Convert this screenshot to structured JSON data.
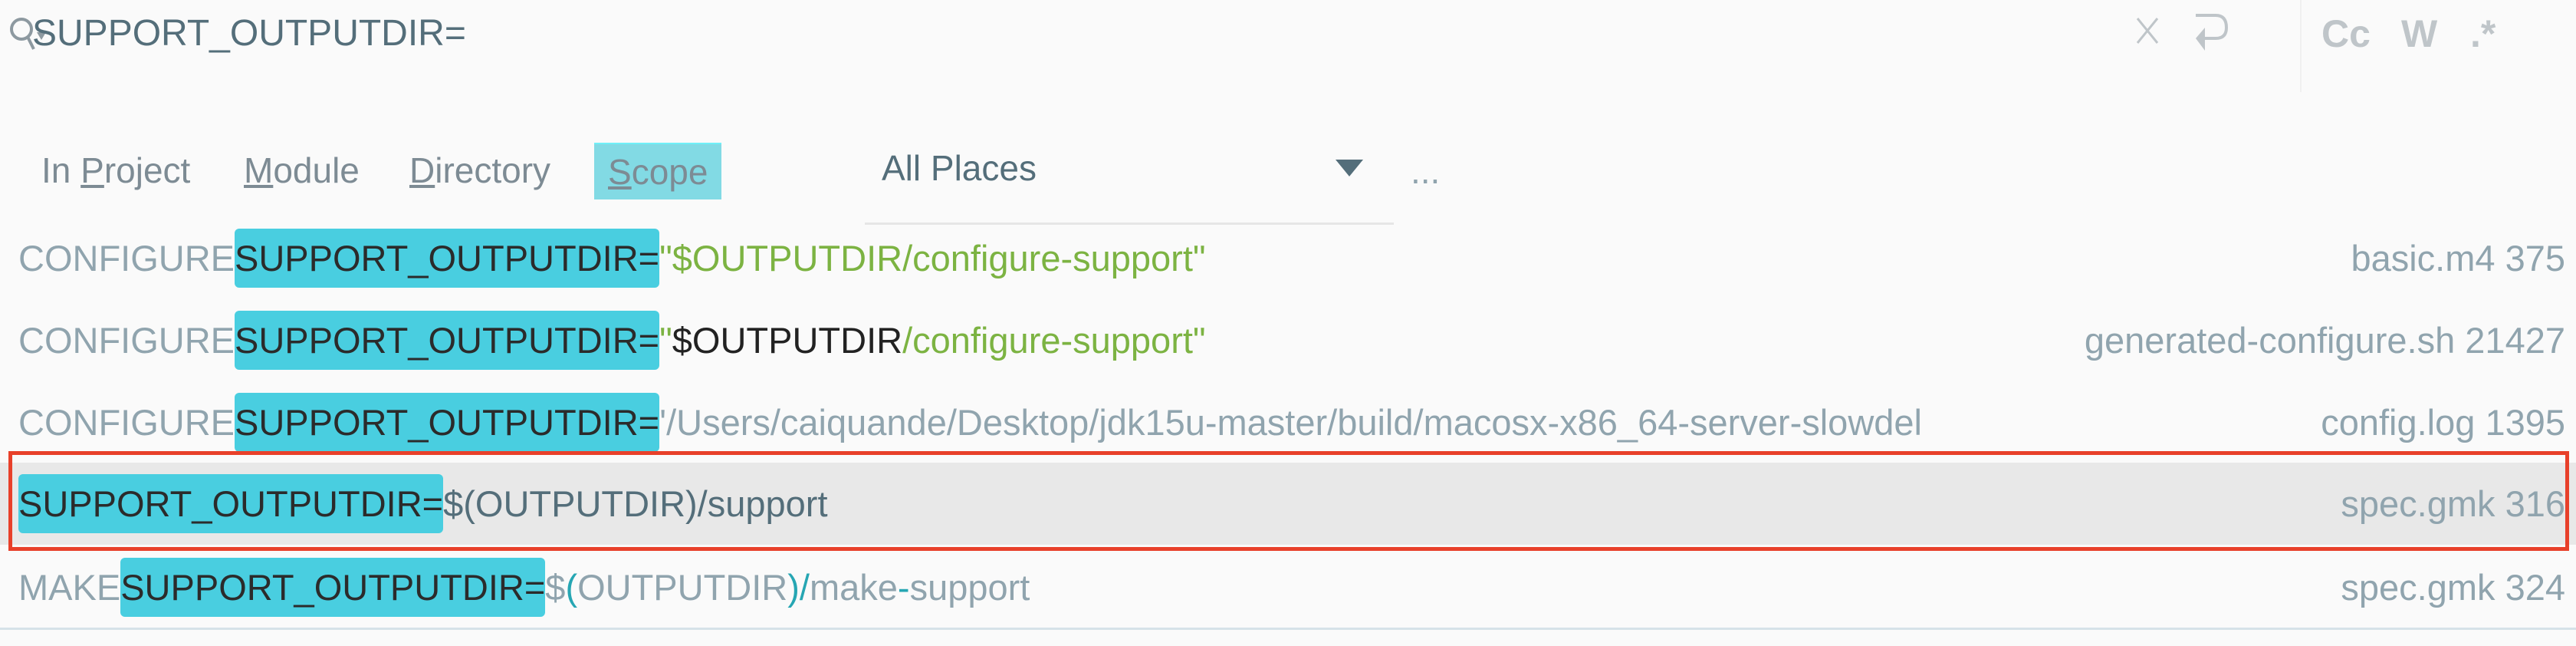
{
  "search": {
    "query": "SUPPORT_OUTPUTDIR=",
    "icons": [
      "search-icon",
      "clear-icon",
      "new-line-icon"
    ],
    "toggles": {
      "match_case": "Cc",
      "words": "W",
      "regex": ".*"
    }
  },
  "scope_tabs": [
    {
      "label": "In Project",
      "mnemonic": "P"
    },
    {
      "label": "Module",
      "mnemonic": "M"
    },
    {
      "label": "Directory",
      "mnemonic": "D"
    },
    {
      "label": "Scope",
      "mnemonic": "S",
      "active": true
    }
  ],
  "scope_select": {
    "value": "All Places"
  },
  "more_label": "...",
  "results": [
    {
      "prefix": "CONFIGURE",
      "match": "SUPPORT_OUTPUTDIR=",
      "rest": [
        "\"$OUTPUTDIR/configure-support\""
      ],
      "file": "basic.m4 375"
    },
    {
      "prefix": "CONFIGURE",
      "match": "SUPPORT_OUTPUTDIR=",
      "rest": [
        "\"",
        "$OUTPUTDIR",
        "/configure-support\""
      ],
      "file": "generated-configure.sh 21427"
    },
    {
      "prefix": "CONFIGURE",
      "match": "SUPPORT_OUTPUTDIR=",
      "rest": [
        "'/Users/caiquande/Desktop/jdk15u-master/build/macosx-x86_64-server-slowdel"
      ],
      "file": "config.log 1395"
    },
    {
      "prefix": "",
      "match": "SUPPORT_OUTPUTDIR=",
      "rest": [
        "$(OUTPUTDIR)/support"
      ],
      "file": "spec.gmk 316",
      "selected": true
    },
    {
      "prefix": "MAKE",
      "match": "SUPPORT_OUTPUTDIR=",
      "rest": [
        "$",
        "(",
        "OUTPUTDIR",
        ")/",
        "make",
        "-",
        "support"
      ],
      "file": "spec.gmk 324"
    }
  ],
  "colors": {
    "match_highlight": "#49cee0",
    "active_tab": "#82dae4",
    "selection_border": "#e8402a",
    "string": "#7cb342"
  }
}
